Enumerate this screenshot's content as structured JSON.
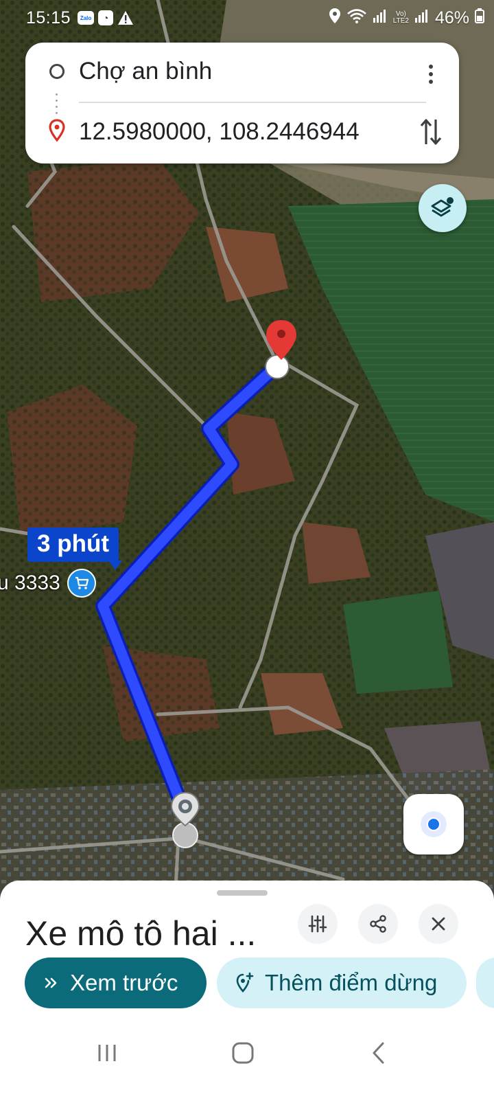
{
  "status_bar": {
    "time": "15:15",
    "zalo_text": "Zalo",
    "network_label_top": "Vo)",
    "network_label_bottom": "LTE2",
    "battery": "46%",
    "icons": [
      "zalo-icon",
      "messenger-icon",
      "warning-icon",
      "location-icon",
      "wifi-icon",
      "signal-icon",
      "battery-icon"
    ]
  },
  "directions": {
    "origin": "Chợ an bình",
    "destination": "12.5980000, 108.2446944"
  },
  "map": {
    "route_time": "3 phút",
    "poi_label": "u 3333",
    "route_color": "#1a3cff",
    "destination_pin_color": "#e53935"
  },
  "sheet": {
    "mode_title": "Xe mô tô hai ...",
    "preview_label": "Xem trước",
    "add_stop_label": "Thêm điểm dừng",
    "accent": "#0b6b7a"
  },
  "nav": {
    "icons": [
      "recents-icon",
      "home-icon",
      "back-icon"
    ]
  }
}
